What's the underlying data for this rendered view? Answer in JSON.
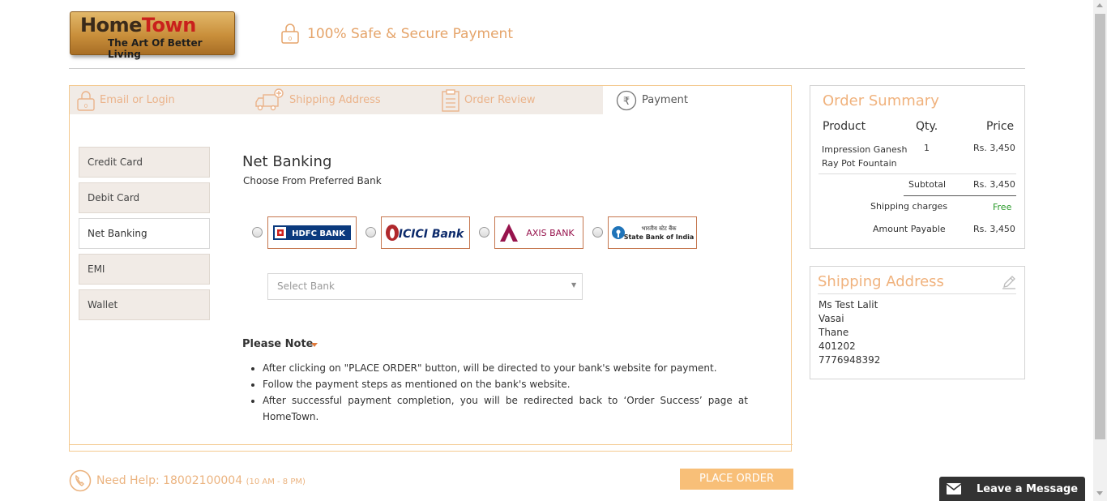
{
  "header": {
    "logo_line1_a": "Home",
    "logo_line1_b": "Town",
    "logo_line2": "The Art Of Better Living",
    "secure_text": "100% Safe & Secure Payment",
    "lock_digit": "0"
  },
  "steps": [
    {
      "label": "Email or Login",
      "icon": "lock-icon",
      "state": "done"
    },
    {
      "label": "Shipping Address",
      "icon": "truck-icon",
      "state": "done"
    },
    {
      "label": "Order Review",
      "icon": "clipboard-icon",
      "state": "done"
    },
    {
      "label": "Payment",
      "icon": "rupee-icon",
      "state": "active"
    }
  ],
  "payment_methods": [
    {
      "label": "Credit Card",
      "active": false
    },
    {
      "label": "Debit Card",
      "active": false
    },
    {
      "label": "Net Banking",
      "active": true
    },
    {
      "label": "EMI",
      "active": false
    },
    {
      "label": "Wallet",
      "active": false
    }
  ],
  "net_banking": {
    "title": "Net Banking",
    "subtitle": "Choose From Preferred Bank",
    "banks": [
      {
        "name": "HDFC BANK",
        "color": "#0b3a7e",
        "accent": "#d0211c"
      },
      {
        "name": "ICICI Bank",
        "color": "#0c2a6b",
        "accent": "#b0282c"
      },
      {
        "name": "AXIS BANK",
        "color": "#97144d",
        "accent": "#97144d"
      },
      {
        "name": "State Bank of India",
        "name_hindi": "भारतीय स्टेट बैंक",
        "color": "#222222",
        "accent": "#1f74b9"
      }
    ],
    "select_placeholder": "Select Bank"
  },
  "note": {
    "title": "Please Note",
    "items": [
      "After clicking on \"PLACE ORDER\" button, will be directed to your bank's website for payment.",
      "Follow the payment steps as mentioned on the bank's website.",
      "After successful payment completion, you will be redirected back to ‘Order Success’ page at HomeTown."
    ]
  },
  "help": {
    "label": "Need Help: 18002100004",
    "hours": "(10 AM - 8 PM)"
  },
  "place_order_label": "PLACE ORDER",
  "order_summary": {
    "title": "Order Summary",
    "col_product": "Product",
    "col_qty": "Qty.",
    "col_price": "Price",
    "product_line1": "Impression Ganesh",
    "product_line2": "Ray Pot Fountain",
    "qty": "1",
    "price": "Rs. 3,450",
    "subtotal_label": "Subtotal",
    "subtotal_value": "Rs. 3,450",
    "shipping_label": "Shipping charges",
    "shipping_value": "Free",
    "payable_label": "Amount Payable",
    "payable_value": "Rs. 3,450"
  },
  "shipping_address": {
    "title": "Shipping Address",
    "lines": [
      "Ms Test Lalit",
      "Vasai",
      "Thane",
      "401202",
      "7776948392"
    ]
  },
  "chat": {
    "label": "Leave a Message"
  },
  "colors": {
    "accent_orange": "#f0b27d",
    "button_orange": "#f8bf78",
    "step_bg": "#f1ebe6",
    "free_green": "#2a9a2a"
  }
}
